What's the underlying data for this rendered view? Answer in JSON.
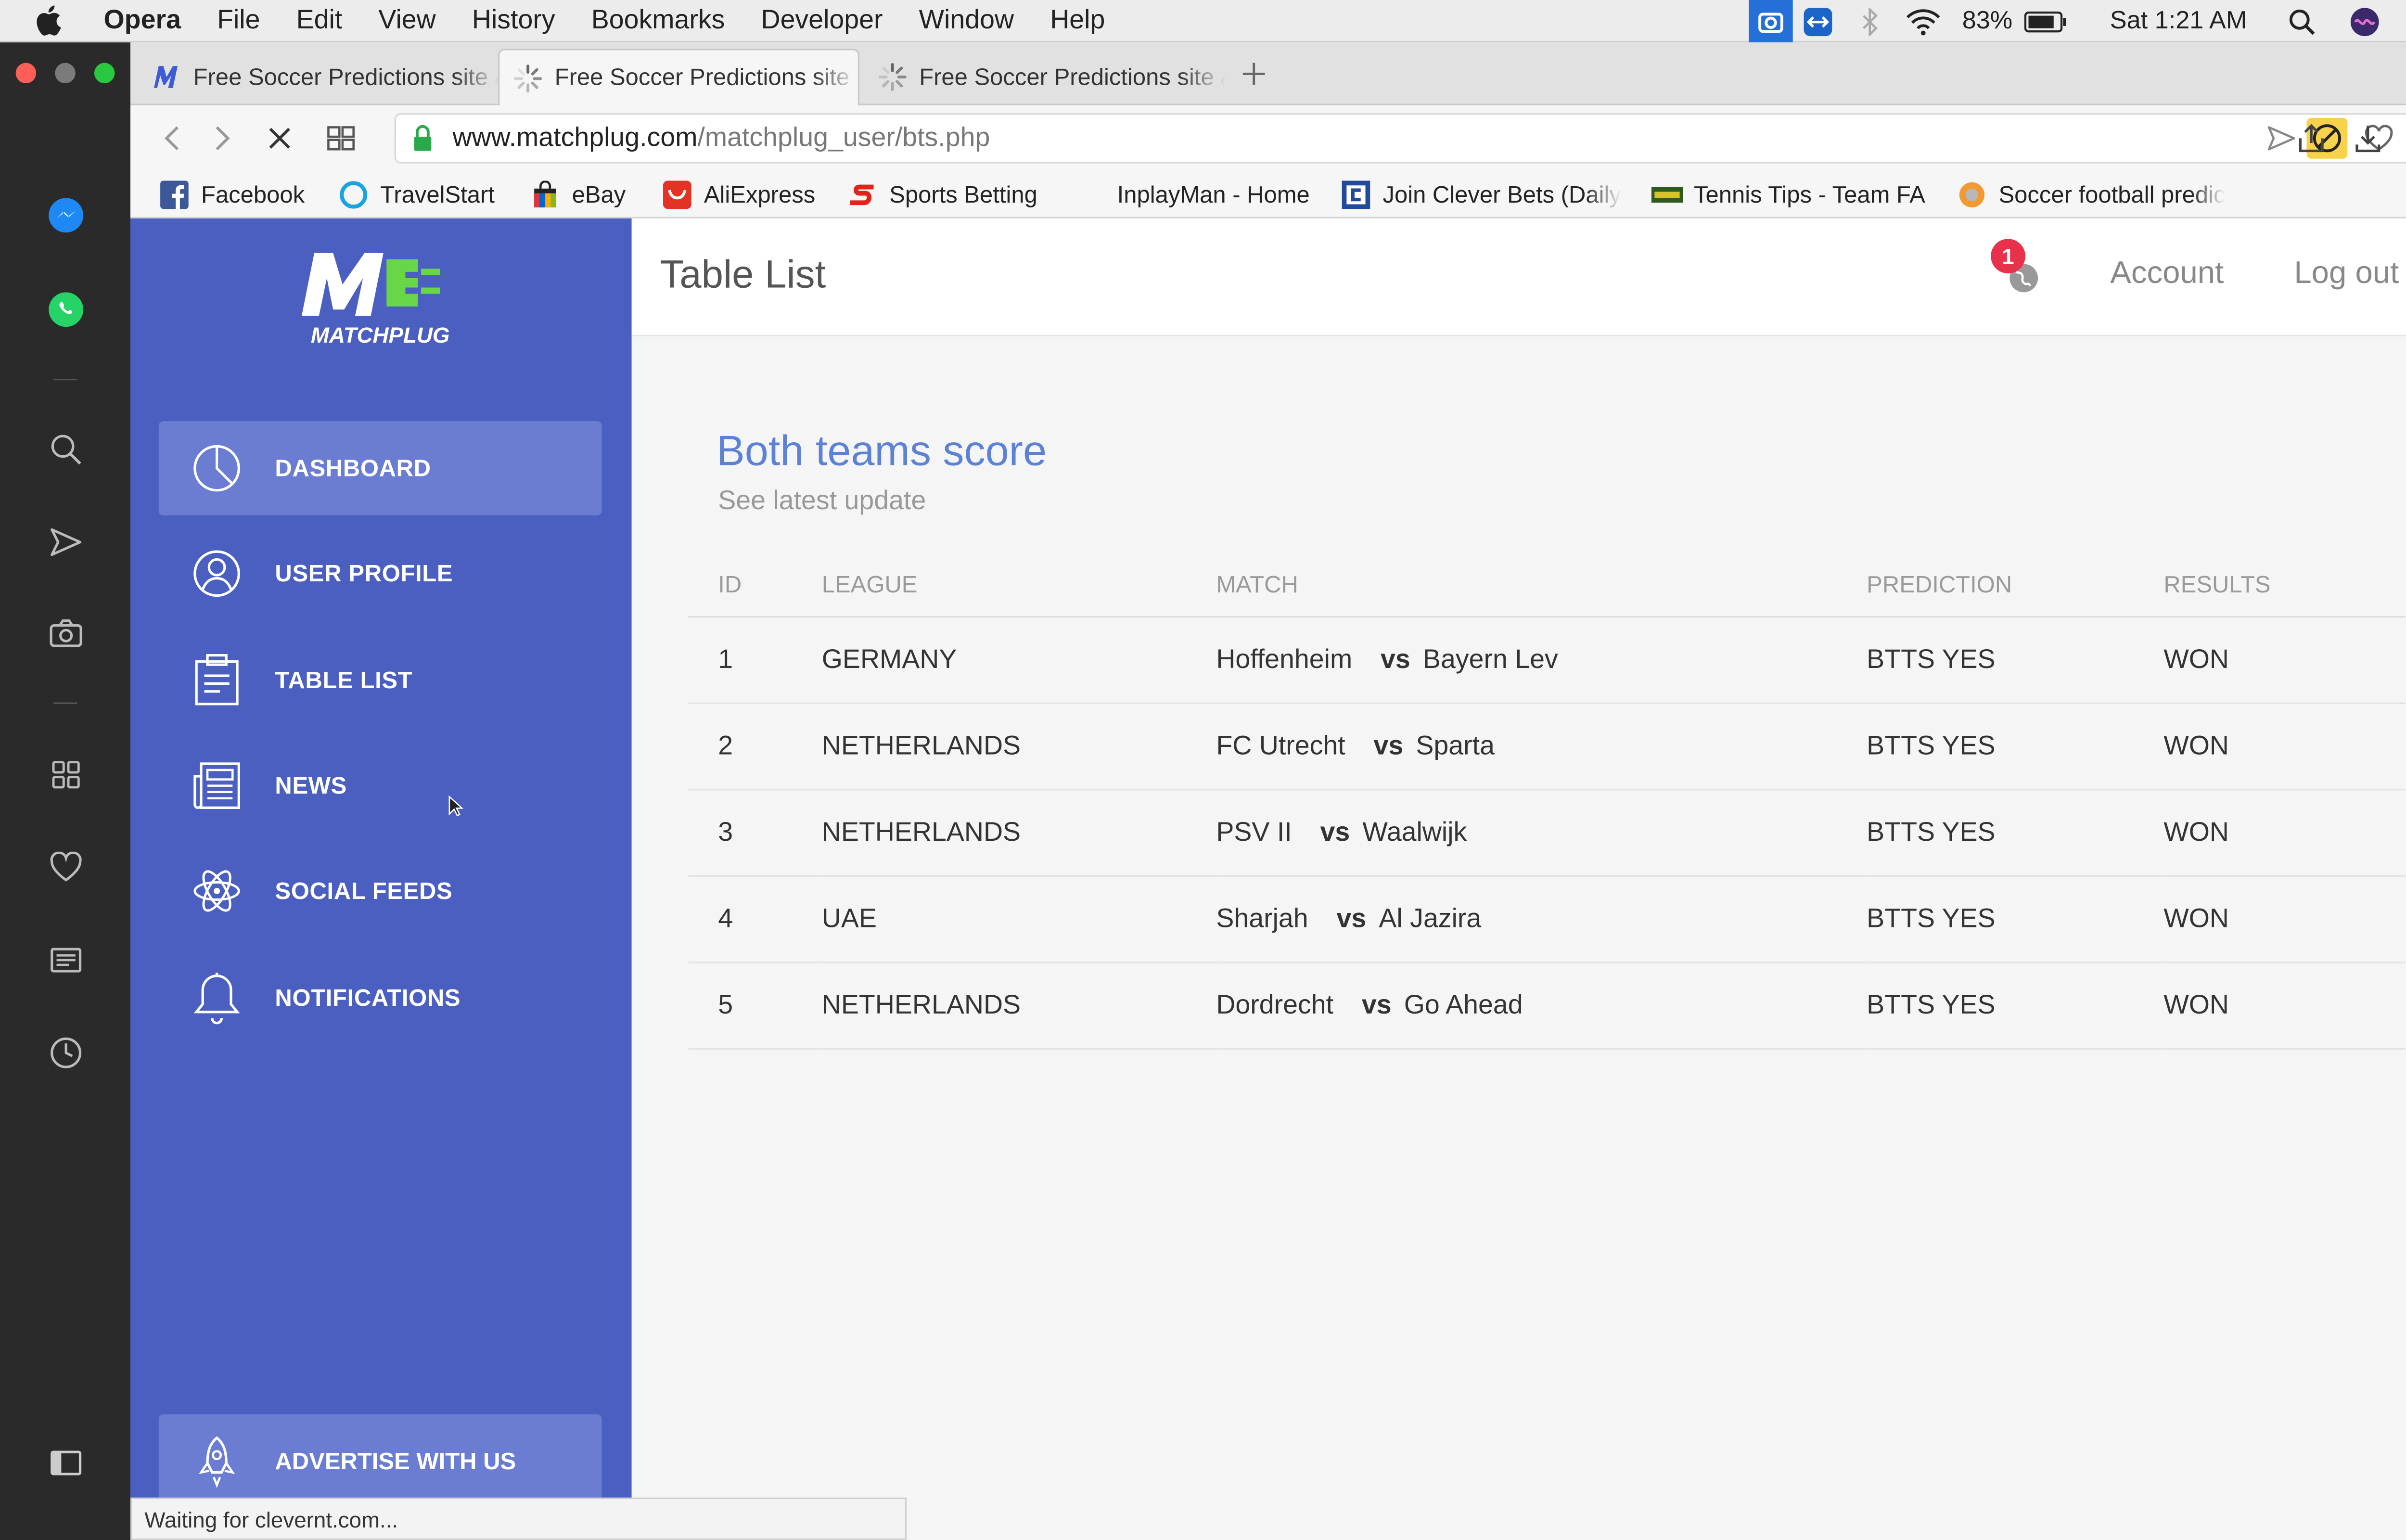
{
  "menubar": {
    "app": "Opera",
    "items": [
      "File",
      "Edit",
      "View",
      "History",
      "Bookmarks",
      "Developer",
      "Window",
      "Help"
    ],
    "battery": "83%",
    "clock": "Sat 1:21 AM"
  },
  "tabs": [
    {
      "title": "Free Soccer Predictions site &",
      "icon": "matchplug-m-icon"
    },
    {
      "title": "Free Soccer Predictions site &",
      "icon": "loading-spinner-icon"
    },
    {
      "title": "Free Soccer Predictions site &",
      "icon": "loading-spinner-icon"
    }
  ],
  "address": {
    "domain": "www.matchplug.com",
    "path": "/matchplug_user/bts.php"
  },
  "bookmarks": [
    {
      "label": "Facebook",
      "icon": "facebook-icon"
    },
    {
      "label": "TravelStart",
      "icon": "travelstart-icon"
    },
    {
      "label": "eBay",
      "icon": "ebay-bag-icon"
    },
    {
      "label": "AliExpress",
      "icon": "aliexpress-icon"
    },
    {
      "label": "Sports Betting",
      "icon": "sports-betting-icon"
    },
    {
      "label": "InplayMan - Home",
      "icon": ""
    },
    {
      "label": "Join Clever Bets (Daily",
      "icon": "cleverbets-icon"
    },
    {
      "label": "Tennis Tips - Team FA",
      "icon": "tennis-tips-icon"
    },
    {
      "label": "Soccer football predic",
      "icon": "soccer-ball-icon"
    }
  ],
  "sidebar": {
    "logo_text": "MATCHPLUG",
    "items": [
      {
        "label": "DASHBOARD",
        "icon": "pie-chart-icon"
      },
      {
        "label": "USER PROFILE",
        "icon": "user-icon"
      },
      {
        "label": "TABLE LIST",
        "icon": "clipboard-icon"
      },
      {
        "label": "NEWS",
        "icon": "newspaper-icon"
      },
      {
        "label": "SOCIAL FEEDS",
        "icon": "atom-icon"
      },
      {
        "label": "NOTIFICATIONS",
        "icon": "bell-icon"
      }
    ],
    "advertise": "ADVERTISE WITH US"
  },
  "header": {
    "title": "Table List",
    "notification_count": "1",
    "account": "Account",
    "logout": "Log out"
  },
  "main": {
    "title": "Both teams score",
    "subtitle": "See latest update",
    "columns": [
      "ID",
      "LEAGUE",
      "MATCH",
      "PREDICTION",
      "RESULTS"
    ],
    "vs_label": "vs",
    "rows": [
      {
        "id": "1",
        "league": "GERMANY",
        "home": "Hoffenheim",
        "away": "Bayern Lev",
        "prediction": "BTTS YES",
        "result": "WON"
      },
      {
        "id": "2",
        "league": "NETHERLANDS",
        "home": "FC Utrecht",
        "away": "Sparta",
        "prediction": "BTTS YES",
        "result": "WON"
      },
      {
        "id": "3",
        "league": "NETHERLANDS",
        "home": "PSV II",
        "away": "Waalwijk",
        "prediction": "BTTS YES",
        "result": "WON"
      },
      {
        "id": "4",
        "league": "UAE",
        "home": "Sharjah",
        "away": "Al Jazira",
        "prediction": "BTTS YES",
        "result": "WON"
      },
      {
        "id": "5",
        "league": "NETHERLANDS",
        "home": "Dordrecht",
        "away": "Go Ahead",
        "prediction": "BTTS YES",
        "result": "WON"
      }
    ]
  },
  "status_bar": "Waiting for clevernt.com...",
  "colors": {
    "sidebar": "#4b5fc0",
    "sidebar_active": "#6a7dd2",
    "title_accent": "#5c82d6",
    "badge": "#e8314a"
  }
}
